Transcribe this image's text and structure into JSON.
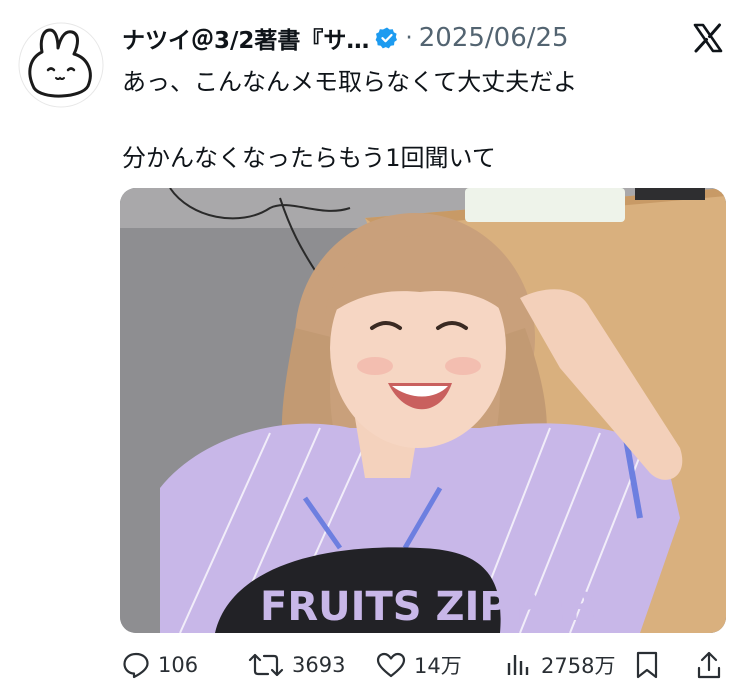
{
  "tweet": {
    "author_name": "ナツイ＠3/2著書『サ…",
    "separator": "·",
    "date": "2025/06/25",
    "line1": "あっ、こんなんメモ取らなくて大丈夫だよ",
    "line2": "分かんなくなったらもう1回聞いて"
  },
  "media": {
    "shirt_text": "FRUITS ZIPPER"
  },
  "icons": {
    "avatar": "bunny-face-avatar",
    "verified": "verified-badge-icon",
    "platform": "x-logo-icon",
    "reply": "reply-icon",
    "repost": "repost-icon",
    "like": "heart-icon",
    "views": "views-bar-chart-icon",
    "bookmark": "bookmark-icon",
    "share": "share-icon"
  },
  "colors": {
    "verified": "#1d9bf0",
    "secondary_text": "#536471",
    "shirt": "#c8b7e8"
  },
  "actions": {
    "reply_count": "106",
    "repost_count": "3693",
    "like_count": "14万",
    "view_count": "2758万"
  }
}
